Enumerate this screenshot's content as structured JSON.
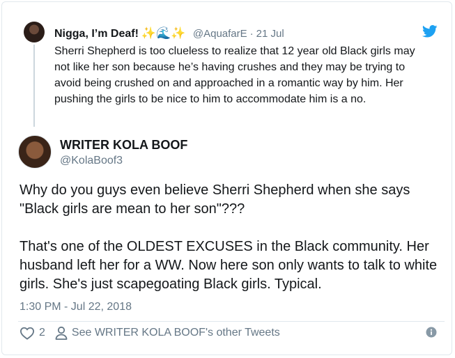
{
  "reply": {
    "name": "Nigga, I’m Deaf!",
    "emoji": "✨🌊✨",
    "handle": "@AquafarE",
    "separator": "·",
    "date": "21 Jul",
    "text": "Sherri Shepherd is too clueless to realize that 12 year old Black girls may not like her son because he’s having crushes and they may be trying to avoid being crushed on and approached in a romantic way by him. Her pushing the girls to be nice to him to accommodate him is a no."
  },
  "tweet": {
    "name": "WRITER KOLA BOOF",
    "handle": "@KolaBoof3",
    "paragraphs": [
      "Why do you guys even believe Sherri Shepherd when she says \"Black girls are mean to her son\"???",
      "That's one of the OLDEST EXCUSES in the Black community. Her husband left her for a WW. Now here son only wants to talk to white girls. She's just scapegoating Black girls. Typical."
    ],
    "timestamp": "1:30 PM - Jul 22, 2018"
  },
  "actions": {
    "like_count": "2",
    "other_tweets_label": "See WRITER KOLA BOOF's other Tweets"
  },
  "icons": {
    "brand": "twitter-bird-icon",
    "like": "heart-icon",
    "profile": "person-icon",
    "info": "info-icon"
  },
  "colors": {
    "twitter_blue": "#1da1f2",
    "secondary_text": "#657786",
    "border": "#e1e8ed"
  }
}
